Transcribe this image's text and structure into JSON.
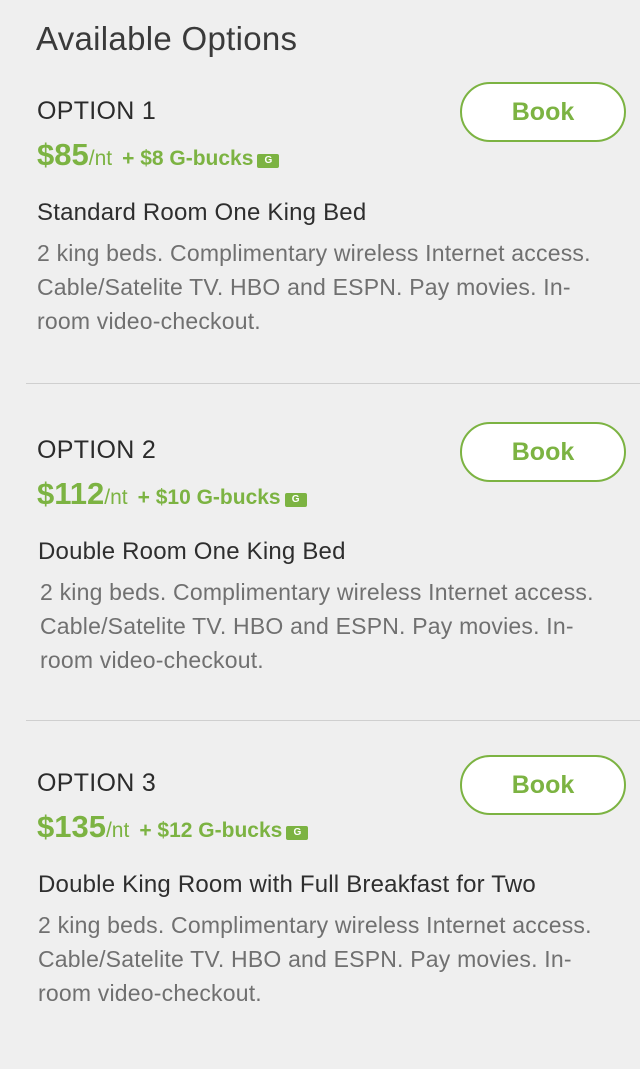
{
  "header": {
    "title": "Available Options"
  },
  "options": [
    {
      "label": "OPTION 1",
      "price": "$85",
      "per_night": "/nt",
      "gbucks": "+ $8 G-bucks",
      "gbucks_icon": "G",
      "room_name": "Standard Room One King Bed",
      "description": "2 king beds. Complimentary wireless Internet access. Cable/Satelite TV. HBO and ESPN. Pay movies. In- room video-checkout.",
      "book_label": "Book"
    },
    {
      "label": "OPTION 2",
      "price": "$112",
      "per_night": "/nt",
      "gbucks": "+ $10 G-bucks",
      "gbucks_icon": "G",
      "room_name": "Double Room One King Bed",
      "description": "2 king beds. Complimentary wireless Internet access. Cable/Satelite TV. HBO and ESPN. Pay movies. In- room video-checkout.",
      "book_label": "Book"
    },
    {
      "label": "OPTION 3",
      "price": "$135",
      "per_night": "/nt",
      "gbucks": "+ $12 G-bucks",
      "gbucks_icon": "G",
      "room_name": "Double King Room with Full Breakfast for Two",
      "description": "2 king beds. Complimentary wireless Internet access. Cable/Satelite TV. HBO and ESPN. Pay movies. In- room video-checkout.",
      "book_label": "Book"
    }
  ],
  "colors": {
    "accent": "#7cb342",
    "background": "#efefef",
    "divider": "#cfcfcf"
  }
}
